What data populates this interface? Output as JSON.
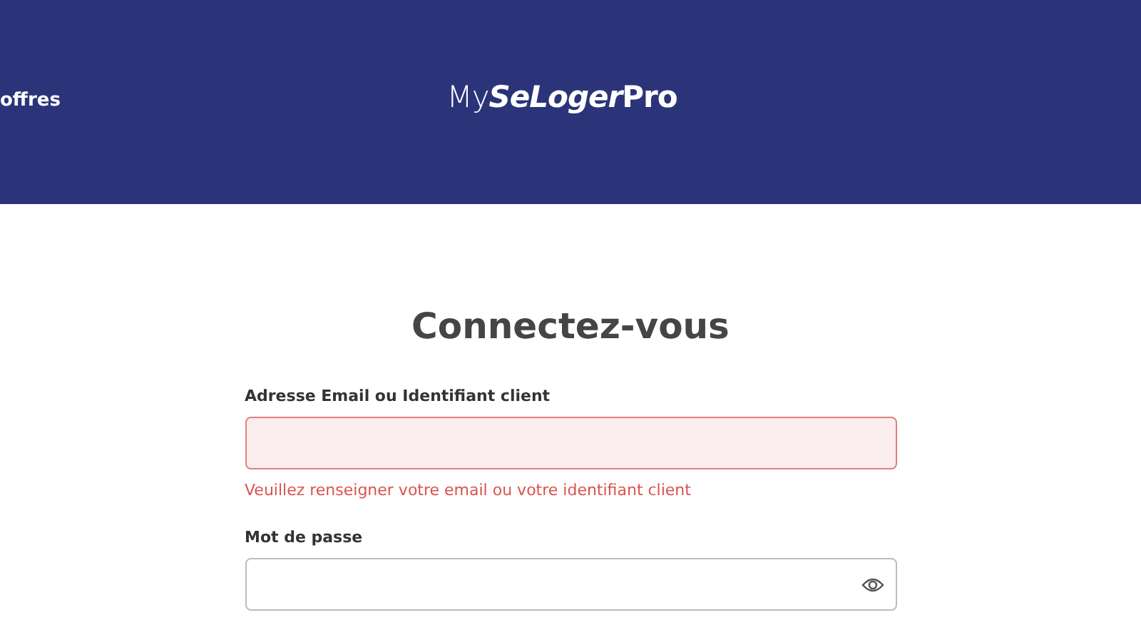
{
  "header": {
    "nav_text": "offres",
    "logo": [
      {
        "text": "My",
        "kind": "light"
      },
      {
        "text": "SeLoger",
        "kind": "bold-italic"
      },
      {
        "text": "Pro",
        "kind": "bold"
      }
    ]
  },
  "title": "Connectez-vous",
  "fields": [
    {
      "label": "Adresse Email ou Identifiant client",
      "kind": "text",
      "error": true,
      "error_text": "Veuillez renseigner votre email ou votre identifiant client"
    },
    {
      "label": "Mot de passe",
      "kind": "password",
      "error": false
    }
  ]
}
